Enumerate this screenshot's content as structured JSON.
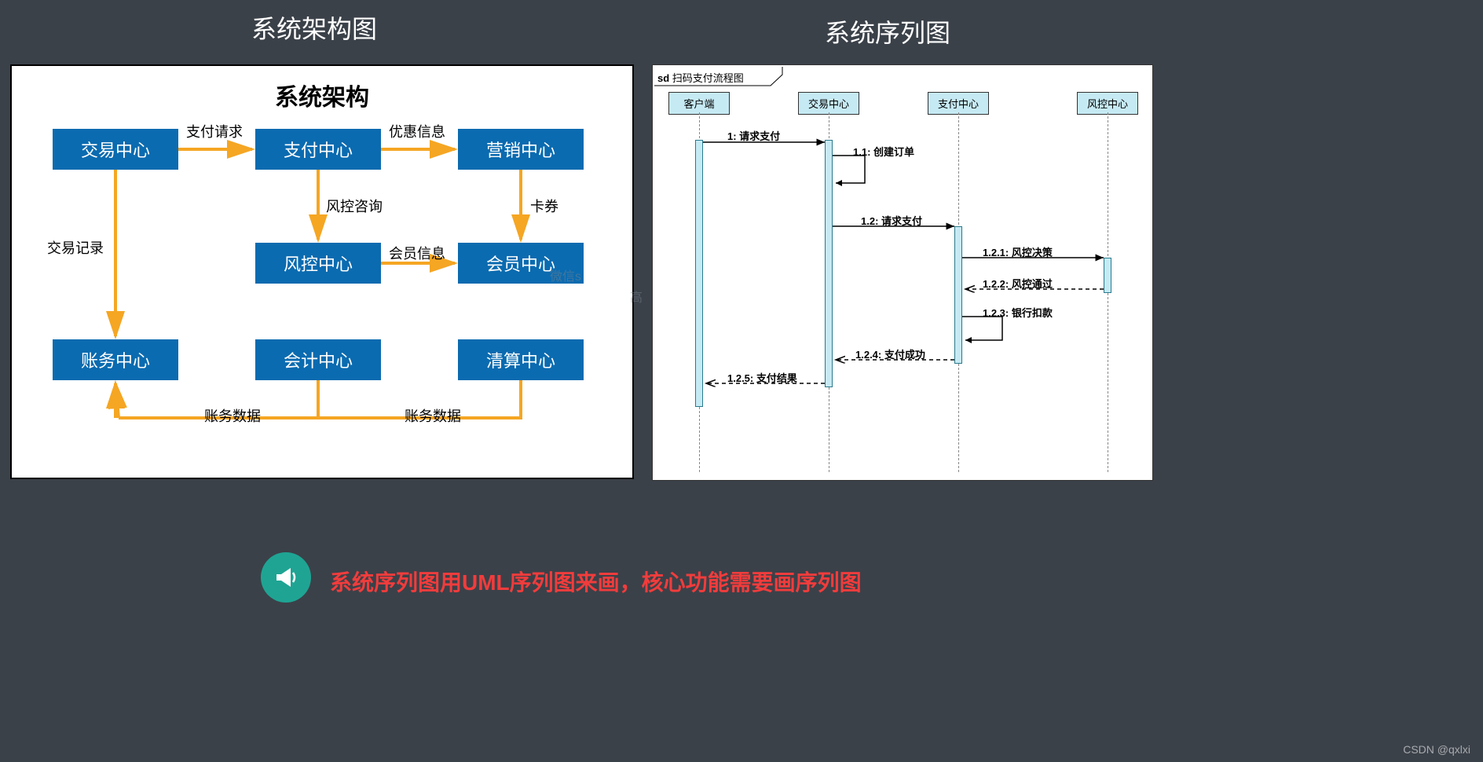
{
  "titles": {
    "left": "系统架构图",
    "right": "系统序列图"
  },
  "architecture": {
    "panel_title": "系统架构",
    "boxes": {
      "trade": "交易中心",
      "pay": "支付中心",
      "marketing": "营销中心",
      "risk": "风控中心",
      "member": "会员中心",
      "account": "账务中心",
      "accounting": "会计中心",
      "clearing": "清算中心"
    },
    "edge_labels": {
      "pay_request": "支付请求",
      "discount_info": "优惠信息",
      "risk_consult": "风控咨询",
      "card_coupon": "卡券",
      "member_info": "会员信息",
      "trade_record": "交易记录",
      "account_data_1": "账务数据",
      "account_data_2": "账务数据"
    }
  },
  "sequence": {
    "frame_prefix": "sd",
    "frame_title": "扫码支付流程图",
    "lifelines": {
      "client": "客户端",
      "trade": "交易中心",
      "pay": "支付中心",
      "risk": "风控中心"
    },
    "messages": {
      "m1": "1: 请求支付",
      "m11": "1.1: 创建订单",
      "m12": "1.2: 请求支付",
      "m121": "1.2.1: 风控决策",
      "m122": "1.2.2: 风控通过",
      "m123": "1.2.3: 银行扣款",
      "m124": "1.2.4: 支付成功",
      "m125": "1.2.5: 支付结果"
    }
  },
  "callout": {
    "text_a": "系统序列图用",
    "text_b": "UML",
    "text_c": "序列图来画，核心功能需要画序列图"
  },
  "watermark": "CSDN @qxlxi",
  "ghost": {
    "l1": "微信s",
    "l2": "高"
  }
}
